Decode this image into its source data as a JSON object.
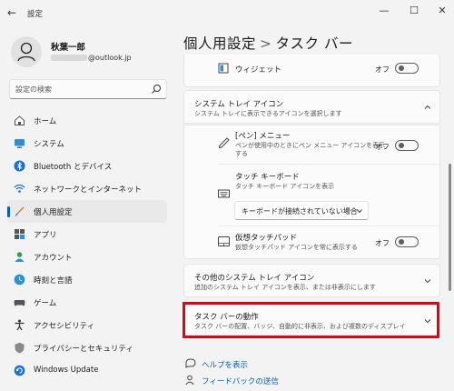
{
  "window": {
    "title": "設定",
    "back_symbol": "←",
    "minimize_symbol": "—",
    "maximize_symbol": "☐",
    "close_symbol": "✕"
  },
  "user": {
    "name": "秋葉一郎",
    "email_suffix": "@outlook.jp"
  },
  "search": {
    "placeholder": "設定の検索"
  },
  "nav": {
    "items": [
      {
        "label": "ホーム",
        "icon": "home-icon"
      },
      {
        "label": "システム",
        "icon": "system-icon"
      },
      {
        "label": "Bluetooth とデバイス",
        "icon": "bluetooth-icon"
      },
      {
        "label": "ネットワークとインターネット",
        "icon": "network-icon"
      },
      {
        "label": "個人用設定",
        "icon": "personalization-icon",
        "selected": true
      },
      {
        "label": "アプリ",
        "icon": "apps-icon"
      },
      {
        "label": "アカウント",
        "icon": "accounts-icon"
      },
      {
        "label": "時刻と言語",
        "icon": "time-language-icon"
      },
      {
        "label": "ゲーム",
        "icon": "gaming-icon"
      },
      {
        "label": "アクセシビリティ",
        "icon": "accessibility-icon"
      },
      {
        "label": "プライバシーとセキュリティ",
        "icon": "privacy-icon"
      },
      {
        "label": "Windows Update",
        "icon": "windows-update-icon"
      }
    ]
  },
  "breadcrumb": {
    "parent": "個人用設定",
    "separator": ">",
    "current": "タスク バー"
  },
  "widget_row": {
    "label": "ウィジェット",
    "state": "オフ",
    "on": false
  },
  "tray_icons": {
    "title": "システム トレイ アイコン",
    "subtitle": "システム トレイに表示できるアイコンを選択します",
    "expanded": true,
    "pen_menu": {
      "title": "[ペン] メニュー",
      "subtitle_line1": "ペンが使用中のときにペン メニュー アイコンを表示",
      "subtitle_line2": "する",
      "state": "オフ",
      "on": false
    },
    "touch_keyboard": {
      "title": "タッチ キーボード",
      "subtitle": "タッチ キーボード アイコンを表示",
      "selected_option": "キーボードが接続されていない場合"
    },
    "virtual_touchpad": {
      "title": "仮想タッチパッド",
      "subtitle": "仮想タッチパッド アイコンを常に表示する",
      "state": "オフ",
      "on": false
    }
  },
  "other_tray_icons": {
    "title": "その他のシステム トレイ アイコン",
    "subtitle": "追加のシステム トレイ アイコンを表示、または非表示にします"
  },
  "taskbar_behavior": {
    "title": "タスク バーの動作",
    "subtitle": "タスク バーの配置、バッジ、自動的に非表示、および複数のディスプレイ"
  },
  "links": {
    "help": "ヘルプを表示",
    "feedback": "フィードバックの送信"
  },
  "colors": {
    "accent": "#005fb8",
    "highlight": "#e60012"
  }
}
